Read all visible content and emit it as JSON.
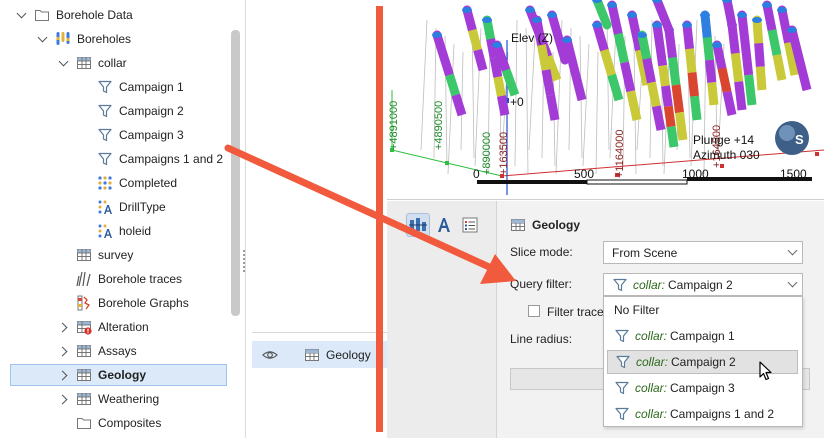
{
  "tree": {
    "items": [
      {
        "label": "Borehole Data",
        "name": "tree-item-borehole-data",
        "icon": "folder-icon",
        "expander": "down",
        "indent": 0
      },
      {
        "label": "Boreholes",
        "name": "tree-item-boreholes",
        "icon": "boreholes-icon",
        "expander": "down",
        "indent": 1
      },
      {
        "label": "collar",
        "name": "tree-item-collar",
        "icon": "table-icon",
        "expander": "down",
        "indent": 2
      },
      {
        "label": "Campaign 1",
        "name": "tree-item-campaign-1",
        "icon": "filter-icon",
        "expander": "",
        "indent": 3
      },
      {
        "label": "Campaign 2",
        "name": "tree-item-campaign-2",
        "icon": "filter-icon",
        "expander": "",
        "indent": 3
      },
      {
        "label": "Campaign 3",
        "name": "tree-item-campaign-3",
        "icon": "filter-icon",
        "expander": "",
        "indent": 3
      },
      {
        "label": "Campaigns 1 and 2",
        "name": "tree-item-campaigns-1-and-2",
        "icon": "filter-icon",
        "expander": "",
        "indent": 3
      },
      {
        "label": "Completed",
        "name": "tree-item-completed",
        "icon": "category-column-icon",
        "expander": "",
        "indent": 3
      },
      {
        "label": "DrillType",
        "name": "tree-item-drilltype",
        "icon": "text-column-icon",
        "expander": "",
        "indent": 3
      },
      {
        "label": "holeid",
        "name": "tree-item-holeid",
        "icon": "text-column-icon",
        "expander": "",
        "indent": 3
      },
      {
        "label": "survey",
        "name": "tree-item-survey",
        "icon": "table-icon",
        "expander": "",
        "indent": 2
      },
      {
        "label": "Borehole traces",
        "name": "tree-item-borehole-traces",
        "icon": "traces-icon",
        "expander": "",
        "indent": 2
      },
      {
        "label": "Borehole Graphs",
        "name": "tree-item-borehole-graphs",
        "icon": "graphs-icon",
        "expander": "",
        "indent": 2
      },
      {
        "label": "Alteration",
        "name": "tree-item-alteration",
        "icon": "table-error-icon",
        "expander": "right",
        "indent": 2
      },
      {
        "label": "Assays",
        "name": "tree-item-assays",
        "icon": "table-icon",
        "expander": "right",
        "indent": 2
      },
      {
        "label": "Geology",
        "name": "tree-item-geology",
        "icon": "table-icon",
        "expander": "right",
        "indent": 2,
        "selected": true
      },
      {
        "label": "Weathering",
        "name": "tree-item-weathering",
        "icon": "table-icon",
        "expander": "right",
        "indent": 2
      },
      {
        "label": "Composites",
        "name": "tree-item-composites",
        "icon": "folder-icon",
        "expander": "",
        "indent": 2
      }
    ]
  },
  "scene": {
    "elev_label": "Elev (Z)",
    "axis_zero": "+0",
    "grid_labels": [
      "+4891000",
      "+4890500",
      "+890000",
      "+163500",
      "+1164000",
      "+164500"
    ],
    "scale_labels": [
      "0",
      "500",
      "1000",
      "1500"
    ],
    "plunge": "Plunge +14",
    "azimuth": "Azimuth 030",
    "compass_letter": "S"
  },
  "visibility_list": {
    "item_label": "Geology",
    "item_icon": "table-icon",
    "eye_icon": "eye-icon"
  },
  "properties": {
    "tabs": [
      "bar-chart-tab-icon",
      "text-tab-icon",
      "list-tab-icon"
    ],
    "header": "Geology",
    "slice_mode_label": "Slice mode:",
    "slice_mode_value": "From Scene",
    "query_filter_label": "Query filter:",
    "query_filter_table": "collar:",
    "query_filter_value": "Campaign 2",
    "filter_traces_label": "Filter trace",
    "line_radius_label": "Line radius:"
  },
  "dropdown": {
    "options": [
      {
        "table": "",
        "label": "No Filter",
        "icon": ""
      },
      {
        "table": "collar:",
        "label": "Campaign 1",
        "icon": "filter-icon"
      },
      {
        "table": "collar:",
        "label": "Campaign 2",
        "icon": "filter-icon",
        "highlighted": true
      },
      {
        "table": "collar:",
        "label": "Campaign 3",
        "icon": "filter-icon"
      },
      {
        "table": "collar:",
        "label": "Campaigns 1 and 2",
        "icon": "filter-icon"
      }
    ]
  },
  "colors": {
    "accent_arrow": "#f15a3c",
    "selection": "#dbe9f8",
    "filter_table_text": "#2f6a1f",
    "hole_purple": "#a33bd6",
    "hole_green": "#3cc86a",
    "hole_red": "#d9452f",
    "hole_yellow": "#c9c93a",
    "hole_blue": "#2f7fe0"
  }
}
